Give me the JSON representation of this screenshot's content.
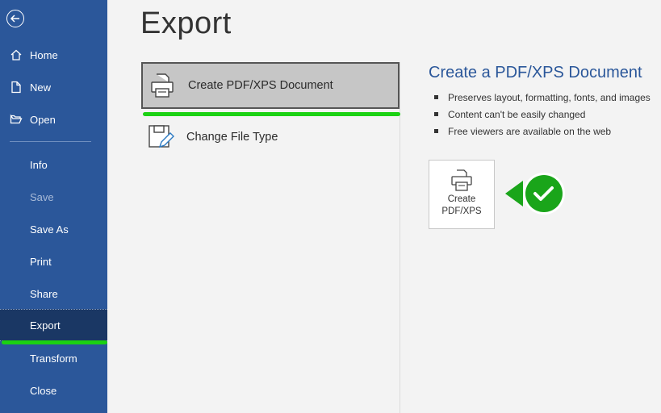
{
  "sidebar": {
    "items": [
      {
        "label": "Home",
        "icon": "home-icon"
      },
      {
        "label": "New",
        "icon": "new-document-icon"
      },
      {
        "label": "Open",
        "icon": "folder-open-icon"
      },
      {
        "label": "Info"
      },
      {
        "label": "Save",
        "state": "disabled"
      },
      {
        "label": "Save As"
      },
      {
        "label": "Print"
      },
      {
        "label": "Share"
      },
      {
        "label": "Export",
        "state": "active"
      },
      {
        "label": "Transform"
      },
      {
        "label": "Close"
      }
    ],
    "colors": {
      "background": "#2b579a",
      "active": "#1a3764"
    }
  },
  "main": {
    "title": "Export",
    "options": [
      {
        "label": "Create PDF/XPS Document",
        "icon": "printer-document-icon",
        "selected": true
      },
      {
        "label": "Change File Type",
        "icon": "save-file-edit-icon",
        "selected": false
      }
    ]
  },
  "detail": {
    "title": "Create a PDF/XPS Document",
    "bullets": [
      "Preserves layout, formatting, fonts, and images",
      "Content can't be easily changed",
      "Free viewers are available on the web"
    ],
    "button": {
      "line1": "Create",
      "line2": "PDF/XPS",
      "icon": "printer-document-icon"
    }
  },
  "annotations": {
    "highlight_color": "#1bd113",
    "check_badge_color": "#1aa51a",
    "check_icon": "checkmark-icon"
  }
}
